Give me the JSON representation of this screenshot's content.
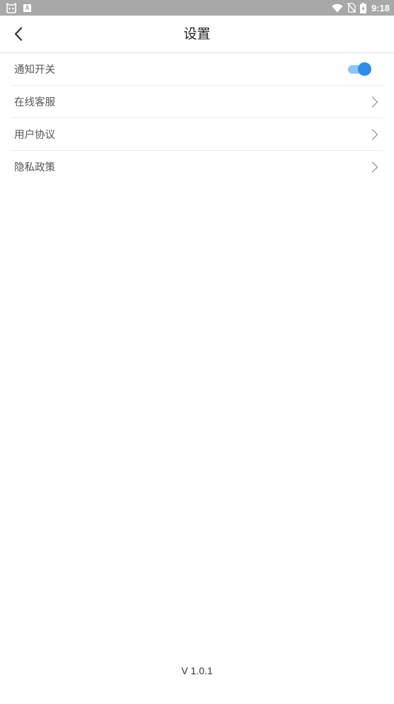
{
  "status_bar": {
    "time": "9:18",
    "left_icons": [
      "debug-face-icon",
      "a-notification-icon"
    ],
    "a_icon_text": "A",
    "right_icons": [
      "wifi-icon",
      "no-sim-icon",
      "battery-charging-icon"
    ]
  },
  "header": {
    "title": "设置",
    "back_icon": "chevron-left-icon"
  },
  "settings": {
    "items": [
      {
        "label": "通知开关",
        "control": "toggle",
        "on": true
      },
      {
        "label": "在线客服",
        "control": "chevron"
      },
      {
        "label": "用户协议",
        "control": "chevron"
      },
      {
        "label": "隐私政策",
        "control": "chevron"
      }
    ]
  },
  "footer": {
    "version": "V 1.0.1"
  },
  "colors": {
    "accent": "#2b8cf0",
    "accent_track": "#8ec5f7",
    "status_bar": "#a8a8a8",
    "text": "#555555",
    "divider": "#ececec"
  }
}
